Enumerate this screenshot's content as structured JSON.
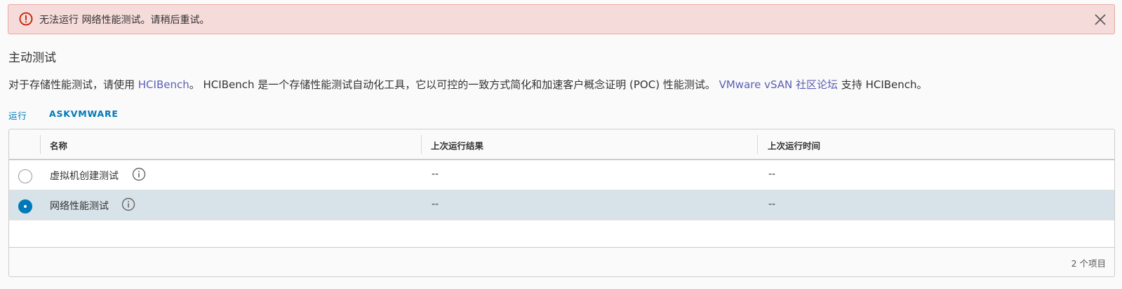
{
  "alert": {
    "message": "无法运行 网络性能测试。请稍后重试。",
    "icon": "error-circle-icon",
    "close_icon": "close-icon",
    "color": "#c21d00"
  },
  "section": {
    "title": "主动测试"
  },
  "description": {
    "part1": "对于存储性能测试，请使用 ",
    "link1": "HCIBench",
    "part2": "。 HCIBench 是一个存储性能测试自动化工具，它以可控的一致方式简化和加速客户概念证明 (POC) 性能测试。 ",
    "link2": "VMware vSAN 社区论坛",
    "part3": " 支持 HCIBench。"
  },
  "actions": {
    "run": "运行",
    "askvmware": "ASKVMWARE"
  },
  "grid": {
    "columns": [
      "名称",
      "上次运行结果",
      "上次运行时间"
    ],
    "rows": [
      {
        "name": "虚拟机创建测试",
        "result": "--",
        "time": "--",
        "selected": false
      },
      {
        "name": "网络性能测试",
        "result": "--",
        "time": "--",
        "selected": true
      }
    ],
    "footer": "2 个项目"
  },
  "colors": {
    "accent": "#0079b8",
    "link": "#5b5fb3",
    "selected_row": "#d8e3e9",
    "alert_bg": "#f5dbd9"
  }
}
